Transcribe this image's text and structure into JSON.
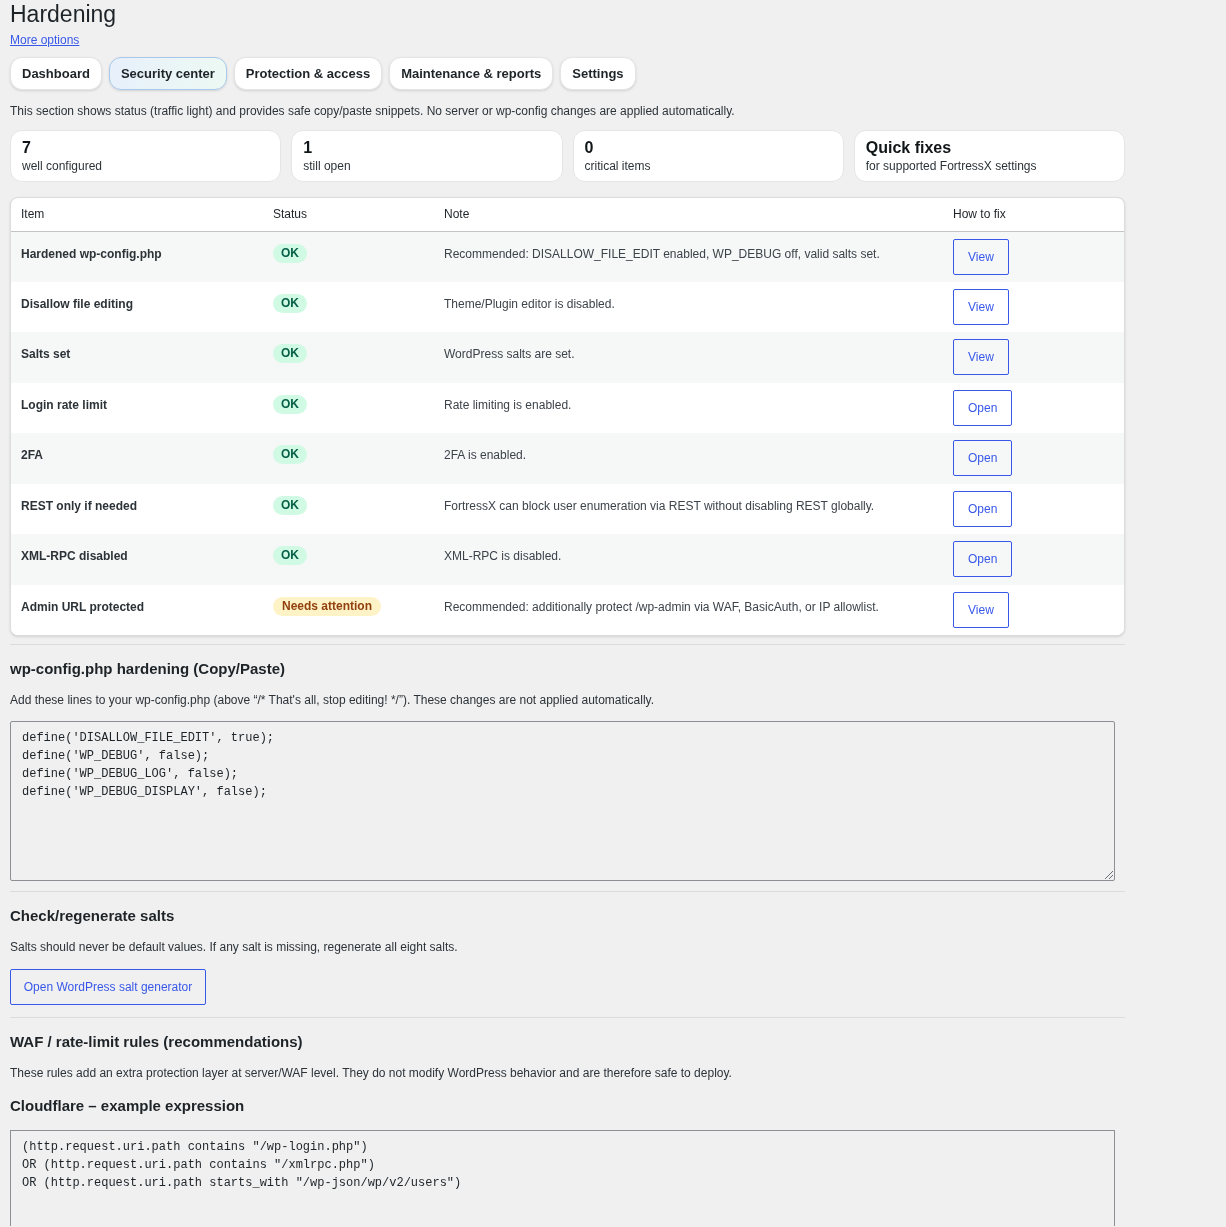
{
  "page": {
    "title": "Hardening",
    "link": "More options"
  },
  "tabs": [
    {
      "label": "Dashboard",
      "selected": false
    },
    {
      "label": "Security center",
      "selected": true
    },
    {
      "label": "Protection & access",
      "selected": false
    },
    {
      "label": "Maintenance & reports",
      "selected": false
    },
    {
      "label": "Settings",
      "selected": false
    }
  ],
  "intro": "This section shows status (traffic light) and provides safe copy/paste snippets. No server or wp-config changes are applied automatically.",
  "stats": [
    {
      "value": "7",
      "label": "well configured"
    },
    {
      "value": "1",
      "label": "still open"
    },
    {
      "value": "0",
      "label": "critical items"
    },
    {
      "value": "Quick fixes",
      "label": "for supported FortressX settings"
    }
  ],
  "table": {
    "columns": [
      "Item",
      "Status",
      "Note",
      "How to fix"
    ],
    "rows": [
      {
        "item": "Hardened wp-config.php",
        "status": {
          "label": "OK",
          "kind": "ok"
        },
        "note": "Recommended: DISALLOW_FILE_EDIT enabled, WP_DEBUG off, valid salts set.",
        "action": "View"
      },
      {
        "item": "Disallow file editing",
        "status": {
          "label": "OK",
          "kind": "ok"
        },
        "note": "Theme/Plugin editor is disabled.",
        "action": "View"
      },
      {
        "item": "Salts set",
        "status": {
          "label": "OK",
          "kind": "ok"
        },
        "note": "WordPress salts are set.",
        "action": "View"
      },
      {
        "item": "Login rate limit",
        "status": {
          "label": "OK",
          "kind": "ok"
        },
        "note": "Rate limiting is enabled.",
        "action": "Open"
      },
      {
        "item": "2FA",
        "status": {
          "label": "OK",
          "kind": "ok"
        },
        "note": "2FA is enabled.",
        "action": "Open"
      },
      {
        "item": "REST only if needed",
        "status": {
          "label": "OK",
          "kind": "ok"
        },
        "note": "FortressX can block user enumeration via REST without disabling REST globally.",
        "action": "Open"
      },
      {
        "item": "XML-RPC disabled",
        "status": {
          "label": "OK",
          "kind": "ok"
        },
        "note": "XML-RPC is disabled.",
        "action": "Open"
      },
      {
        "item": "Admin URL protected",
        "status": {
          "label": "Needs attention",
          "kind": "warning"
        },
        "note": "Recommended: additionally protect /wp-admin via WAF, BasicAuth, or IP allowlist.",
        "action": "View"
      }
    ]
  },
  "sections": [
    {
      "heading": "wp-config.php hardening (Copy/Paste)",
      "description": "Add these lines to your wp-config.php (above “/* That's all, stop editing! */”). These changes are not applied automatically.",
      "code": "define('DISALLOW_FILE_EDIT', true);\ndefine('WP_DEBUG', false);\ndefine('WP_DEBUG_LOG', false);\ndefine('WP_DEBUG_DISPLAY', false);"
    },
    {
      "heading": "Check/regenerate salts",
      "description": "Salts should never be default values. If any salt is missing, regenerate all eight salts.",
      "button": "Open WordPress salt generator"
    },
    {
      "heading": "WAF / rate-limit rules (recommendations)",
      "description": "These rules add an extra protection layer at server/WAF level. They do not modify WordPress behavior and are therefore safe to deploy.",
      "subsections": [
        {
          "heading": "Cloudflare – example expression",
          "code": "(http.request.uri.path contains \"/wp-login.php\")\nOR (http.request.uri.path contains \"/xmlrpc.php\")\nOR (http.request.uri.path starts_with \"/wp-json/wp/v2/users\")"
        }
      ]
    }
  ]
}
